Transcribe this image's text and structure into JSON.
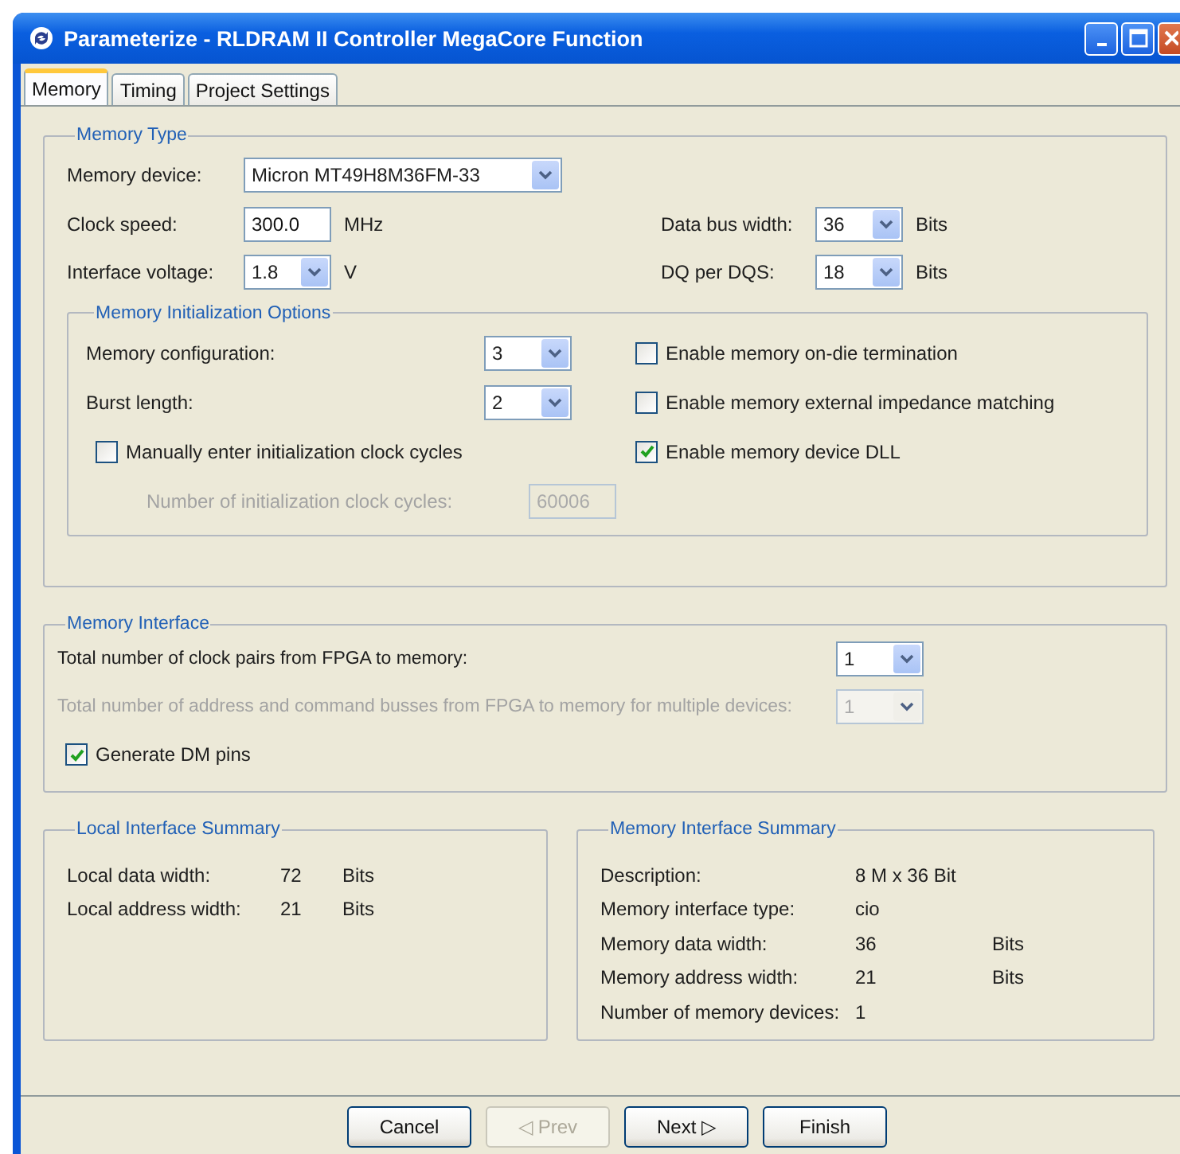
{
  "window": {
    "title": "Parameterize - RLDRAM II Controller MegaCore Function"
  },
  "tabs": [
    {
      "label": "Memory",
      "selected": true
    },
    {
      "label": "Timing",
      "selected": false
    },
    {
      "label": "Project Settings",
      "selected": false
    }
  ],
  "memory_type": {
    "title": "Memory Type",
    "device": {
      "label": "Memory device:",
      "value": "Micron MT49H8M36FM-33"
    },
    "clock_speed": {
      "label": "Clock speed:",
      "value": "300.0",
      "unit": "MHz"
    },
    "interface_voltage": {
      "label": "Interface voltage:",
      "value": "1.8",
      "unit": "V"
    },
    "data_bus_width": {
      "label": "Data bus width:",
      "value": "36",
      "unit": "Bits"
    },
    "dq_per_dqs": {
      "label": "DQ per DQS:",
      "value": "18",
      "unit": "Bits"
    },
    "init_options": {
      "title": "Memory Initialization Options",
      "memory_configuration": {
        "label": "Memory configuration:",
        "value": "3"
      },
      "burst_length": {
        "label": "Burst length:",
        "value": "2"
      },
      "manual_cycles": {
        "label": "Manually enter initialization clock cycles",
        "checked": false
      },
      "cycles_count": {
        "label": "Number of initialization clock cycles:",
        "value": "60006",
        "disabled": true
      },
      "on_die_termination": {
        "label": "Enable memory on-die termination",
        "checked": false
      },
      "external_impedance": {
        "label": "Enable memory external impedance matching",
        "checked": false
      },
      "device_dll": {
        "label": "Enable memory device DLL",
        "checked": true
      }
    }
  },
  "memory_interface": {
    "title": "Memory Interface",
    "clock_pairs": {
      "label": "Total number of clock pairs from FPGA to memory:",
      "value": "1",
      "disabled": false
    },
    "address_busses": {
      "label": "Total number of address and command busses from FPGA to memory for multiple devices:",
      "value": "1",
      "disabled": true
    },
    "generate_dm": {
      "label": "Generate DM pins",
      "checked": true
    }
  },
  "local_summary": {
    "title": "Local Interface Summary",
    "rows": [
      {
        "label": "Local data width:",
        "value": "72",
        "unit": "Bits"
      },
      {
        "label": "Local address width:",
        "value": "21",
        "unit": "Bits"
      }
    ]
  },
  "memory_summary": {
    "title": "Memory Interface Summary",
    "rows": [
      {
        "label": "Description:",
        "value": "8 M x 36 Bit"
      },
      {
        "label": "Memory interface type:",
        "value": "cio"
      },
      {
        "label": "Memory data width:",
        "value": "36",
        "unit": "Bits"
      },
      {
        "label": "Memory address width:",
        "value": "21",
        "unit": "Bits"
      },
      {
        "label": "Number of memory devices:",
        "value": "1"
      }
    ]
  },
  "buttons": [
    {
      "label": "Cancel",
      "disabled": false
    },
    {
      "label": "◁ Prev",
      "disabled": true
    },
    {
      "label": "Next ▷",
      "disabled": false
    },
    {
      "label": "Finish",
      "disabled": false
    }
  ]
}
